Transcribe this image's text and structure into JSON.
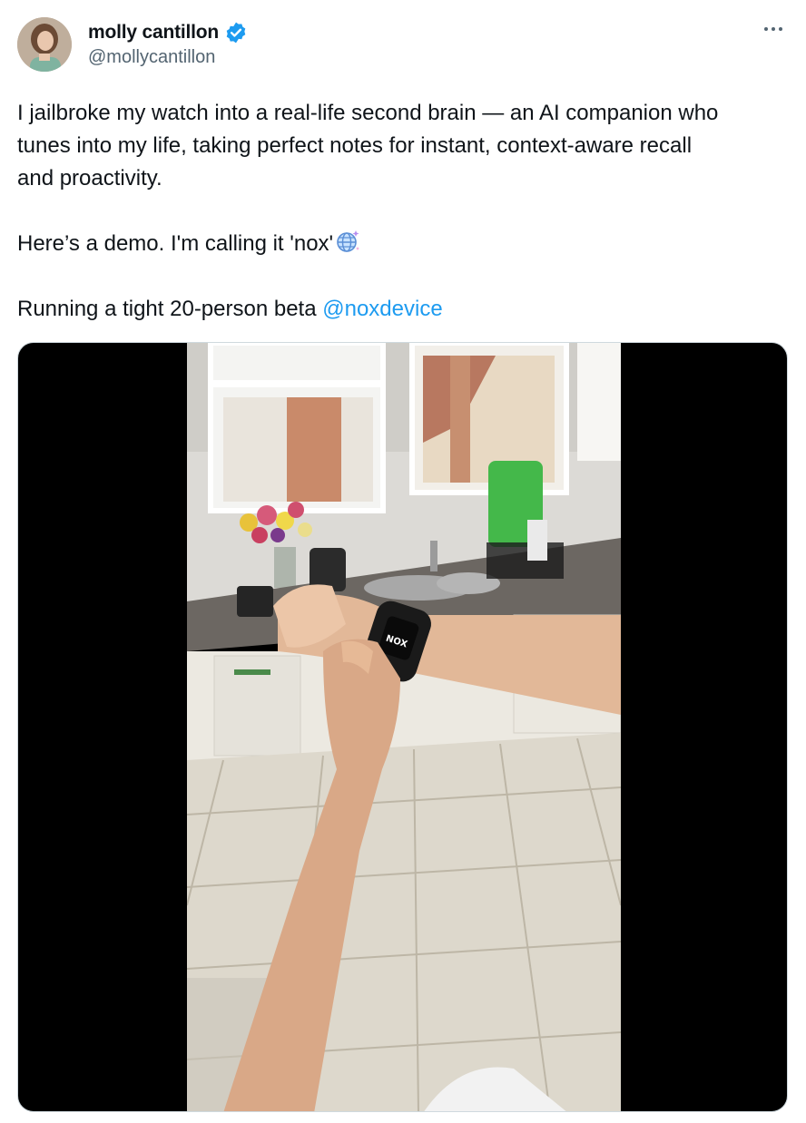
{
  "author": {
    "display_name": "molly cantillon",
    "handle": "@mollycantillon",
    "verified": true,
    "avatar_icon": "profile-photo"
  },
  "more_icon": "more-horizontal-icon",
  "tweet": {
    "line1": "I jailbroke my watch into a real-life second brain — an AI companion who",
    "line2": "tunes into my life, taking perfect notes for instant, context-aware recall",
    "line3": "and proactivity.",
    "line4": "Here’s a demo. I'm calling it 'nox'",
    "line4_emoji": "globe-with-sparkles",
    "line5_prefix": "Running a tight 20-person beta ",
    "line5_mention": "@noxdevice"
  },
  "media": {
    "type": "video",
    "watch_label": "NOX"
  },
  "colors": {
    "text": "#0f1419",
    "secondary": "#536471",
    "link": "#1d9bf0",
    "verified": "#1d9bf0"
  }
}
